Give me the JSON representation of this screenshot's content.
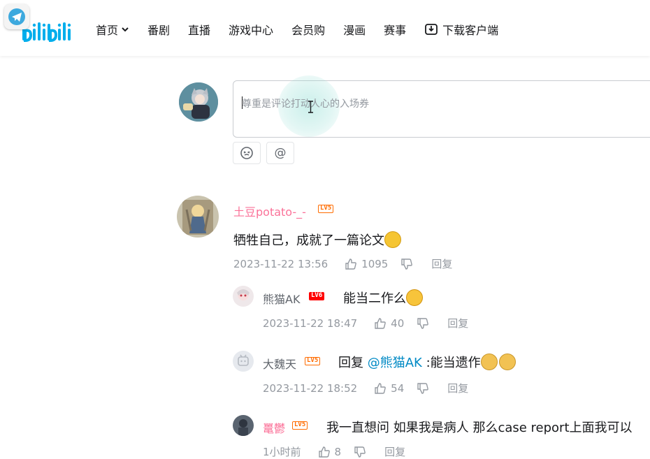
{
  "header": {
    "logo_text": "bilibili",
    "nav": [
      {
        "label": "首页",
        "has_dropdown": true
      },
      {
        "label": "番剧"
      },
      {
        "label": "直播"
      },
      {
        "label": "游戏中心"
      },
      {
        "label": "会员购"
      },
      {
        "label": "漫画"
      },
      {
        "label": "赛事"
      },
      {
        "label": "下载客户端",
        "icon": "download-icon"
      }
    ]
  },
  "composer": {
    "placeholder": "尊重是评论打动人心的入场券",
    "emoji_button_icon": "emoji-face-icon",
    "at_button_label": "@"
  },
  "comments": [
    {
      "username": "土豆potato-_-",
      "level": "LV5",
      "text": "牺牲自己，成就了一篇论文",
      "emoji": "laugh-cry-emoji",
      "time": "2023-11-22 13:56",
      "likes": "1095",
      "reply_label": "回复",
      "replies": [
        {
          "username": "熊猫AK",
          "level": "LV6",
          "text": "能当二作么",
          "emoji": "shocked-emoji",
          "time": "2023-11-22 18:47",
          "likes": "40",
          "reply_label": "回复"
        },
        {
          "username": "大魏天",
          "level": "LV5",
          "text_prefix": "回复 ",
          "mention": "@熊猫AK",
          "text_suffix": " :能当遗作",
          "emoji": "doge-emoji",
          "time": "2023-11-22 18:52",
          "likes": "54",
          "reply_label": "回复"
        },
        {
          "username": "鼍鬱",
          "level": "LV5",
          "text": "我一直想问 如果我是病人 那么case report上面我可以",
          "time": "1小时前",
          "likes": "8",
          "reply_label": "回复"
        }
      ]
    }
  ],
  "colors": {
    "brand_blue": "#00aeec",
    "username_pink": "#fb7299",
    "mention_blue": "#008ac5",
    "level_orange": "#ff6c00"
  }
}
